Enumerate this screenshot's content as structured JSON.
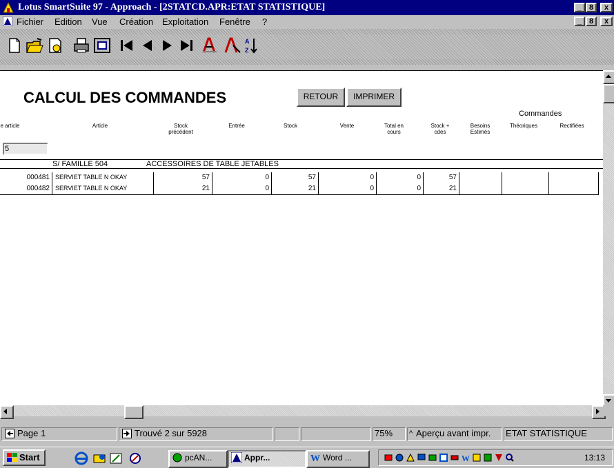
{
  "window": {
    "title": "Lotus SmartSuite 97   - Approach - [2STATCD.APR:ETAT STATISTIQUE]",
    "caption_buttons": [
      "_",
      "8",
      "x"
    ]
  },
  "menubar": {
    "items": [
      "Fichier",
      "Edition",
      "Vue",
      "Création",
      "Exploitation",
      "Fenêtre",
      "?"
    ],
    "doc_buttons": [
      "_",
      "8",
      "x"
    ]
  },
  "toolbar": {
    "icons": [
      "new-doc-icon",
      "open-folder-icon",
      "preview-icon",
      "print-icon",
      "form-icon",
      "first-record-icon",
      "previous-record-icon",
      "next-record-icon",
      "last-record-icon",
      "find-icon",
      "find-all-icon",
      "sort-icon"
    ]
  },
  "report": {
    "title": "CALCUL DES COMMANDES",
    "buttons": {
      "retour": "RETOUR",
      "imprimer": "IMPRIMER"
    },
    "group_header": "Commandes",
    "columns": {
      "code": "de article",
      "article": "Article",
      "stock_prec_1": "Stock",
      "stock_prec_2": "précédent",
      "entree": "Entrée",
      "stock": "Stock",
      "vente": "Vente",
      "total_1": "Total en",
      "total_2": "cours",
      "stock_cdes_1": "Stock +",
      "stock_cdes_2": "cdes",
      "besoins_1": "Besoins",
      "besoins_2": "Estimés",
      "theoriques": "Théoriques",
      "rectifiees": "Rectifiées"
    },
    "filter_value": "5",
    "family": {
      "label": "S/ FAMILLE 504",
      "description": "ACCESSOIRES DE TABLE JETABLES"
    },
    "rows": [
      {
        "code": "000481",
        "article": "SERVIET TABLE N OKAY",
        "stock_prec": "57",
        "entree": "0",
        "stock": "57",
        "vente": "0",
        "total": "0",
        "stock_cdes": "57"
      },
      {
        "code": "000482",
        "article": "SERVIET TABLE N OKAY",
        "stock_prec": "21",
        "entree": "0",
        "stock": "21",
        "vente": "0",
        "total": "0",
        "stock_cdes": "21"
      }
    ]
  },
  "status": {
    "page": "Page 1",
    "found": "Trouvé 2 sur 5928",
    "zoom": "75%",
    "mode": "Aperçu avant impr.",
    "view": "ETAT STATISTIQUE"
  },
  "taskbar": {
    "start": "Start",
    "tasks": [
      "pcAN...",
      "Appr...",
      "Word ..."
    ],
    "clock": "13:13"
  }
}
